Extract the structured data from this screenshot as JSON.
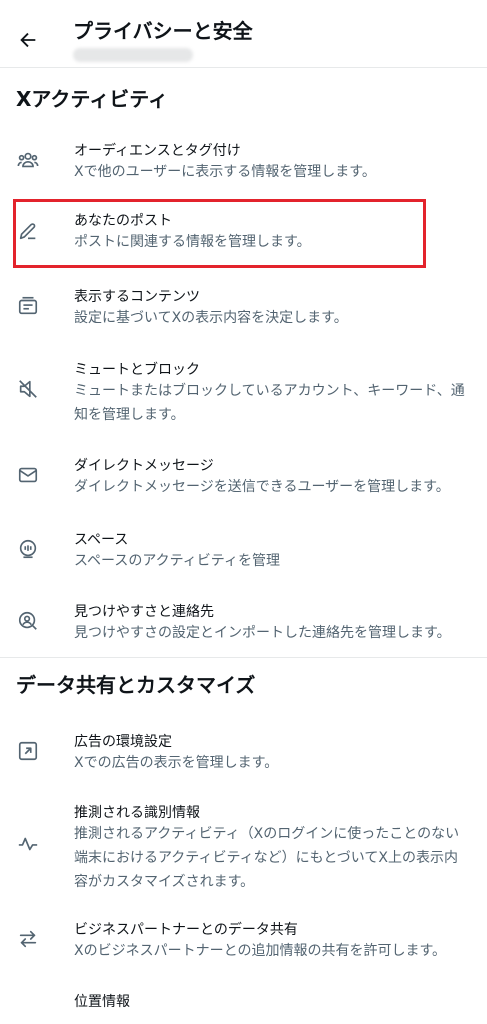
{
  "header": {
    "title": "プライバシーと安全"
  },
  "sections": {
    "activity": {
      "title": "Xアクティビティ"
    },
    "data_sharing": {
      "title": "データ共有とカスタマイズ"
    }
  },
  "items": {
    "audience": {
      "title": "オーディエンスとタグ付け",
      "desc": "Xで他のユーザーに表示する情報を管理します。",
      "icon": "people-icon"
    },
    "your_posts": {
      "title": "あなたのポスト",
      "desc": "ポストに関連する情報を管理します。",
      "icon": "pencil-icon"
    },
    "content": {
      "title": "表示するコンテンツ",
      "desc": "設定に基づいてXの表示内容を決定します。",
      "icon": "content-icon"
    },
    "mute_block": {
      "title": "ミュートとブロック",
      "desc": "ミュートまたはブロックしているアカウント、キーワード、通知を管理します。",
      "icon": "mute-icon"
    },
    "dm": {
      "title": "ダイレクトメッセージ",
      "desc": "ダイレクトメッセージを送信できるユーザーを管理します。",
      "icon": "envelope-icon"
    },
    "spaces": {
      "title": "スペース",
      "desc": "スペースのアクティビティを管理",
      "icon": "spaces-icon"
    },
    "discoverability": {
      "title": "見つけやすさと連絡先",
      "desc": "見つけやすさの設定とインポートした連絡先を管理します。",
      "icon": "contacts-icon"
    },
    "ads": {
      "title": "広告の環境設定",
      "desc": "Xでの広告の表示を管理します。",
      "icon": "ads-icon"
    },
    "inferred": {
      "title": "推測される識別情報",
      "desc": "推測されるアクティビティ（Xのログインに使ったことのない端末におけるアクティビティなど）にもとづいてX上の表示内容がカスタマイズされます。",
      "icon": "pulse-icon"
    },
    "partners": {
      "title": "ビジネスパートナーとのデータ共有",
      "desc": "Xのビジネスパートナーとの追加情報の共有を許可します。",
      "icon": "swap-arrows-icon"
    },
    "location": {
      "title": "位置情報"
    }
  },
  "colors": {
    "text_primary": "#0f1419",
    "text_secondary": "#536471",
    "divider": "#e7e9ea",
    "highlight": "#e3232c"
  }
}
